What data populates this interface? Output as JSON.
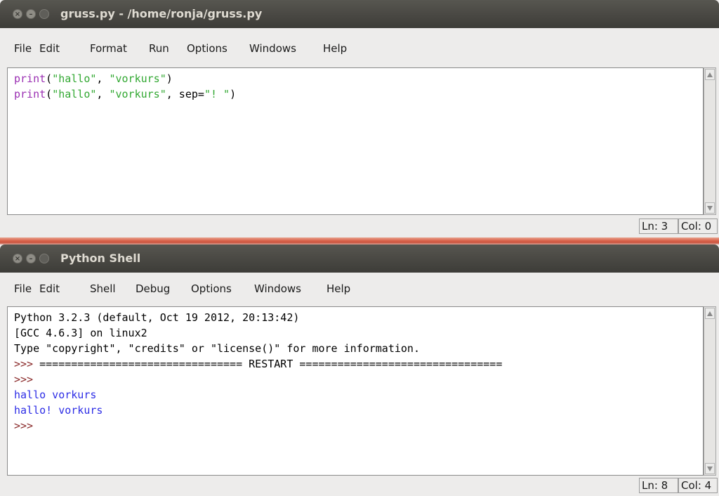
{
  "editor": {
    "title": "gruss.py - /home/ronja/gruss.py",
    "menu": [
      "File",
      "Edit",
      "Format",
      "Run",
      "Options",
      "Windows",
      "Help"
    ],
    "lines": [
      [
        {
          "t": "print",
          "c": "kw"
        },
        {
          "t": "(",
          "c": ""
        },
        {
          "t": "\"hallo\"",
          "c": "str"
        },
        {
          "t": ", ",
          "c": ""
        },
        {
          "t": "\"vorkurs\"",
          "c": "str"
        },
        {
          "t": ")",
          "c": ""
        }
      ],
      [
        {
          "t": "print",
          "c": "kw"
        },
        {
          "t": "(",
          "c": ""
        },
        {
          "t": "\"hallo\"",
          "c": "str"
        },
        {
          "t": ", ",
          "c": ""
        },
        {
          "t": "\"vorkurs\"",
          "c": "str"
        },
        {
          "t": ", sep=",
          "c": ""
        },
        {
          "t": "\"! \"",
          "c": "str"
        },
        {
          "t": ")",
          "c": ""
        }
      ]
    ],
    "status": {
      "ln": "Ln: 3",
      "col": "Col: 0"
    }
  },
  "shell": {
    "title": "Python Shell",
    "menu": [
      "File",
      "Edit",
      "Shell",
      "Debug",
      "Options",
      "Windows",
      "Help"
    ],
    "lines": [
      [
        {
          "t": "Python 3.2.3 (default, Oct 19 2012, 20:13:42)",
          "c": ""
        }
      ],
      [
        {
          "t": "[GCC 4.6.3] on linux2",
          "c": ""
        }
      ],
      [
        {
          "t": "Type \"copyright\", \"credits\" or \"license()\" for more information.",
          "c": ""
        }
      ],
      [
        {
          "t": ">>> ",
          "c": "prompt"
        },
        {
          "t": "================================ RESTART ================================",
          "c": ""
        }
      ],
      [
        {
          "t": ">>> ",
          "c": "prompt"
        }
      ],
      [
        {
          "t": "hallo vorkurs",
          "c": "out"
        }
      ],
      [
        {
          "t": "hallo! vorkurs",
          "c": "out"
        }
      ],
      [
        {
          "t": ">>> ",
          "c": "prompt"
        }
      ]
    ],
    "status": {
      "ln": "Ln: 8",
      "col": "Col: 4"
    }
  },
  "colors": {
    "keyword": "#9b31b3",
    "string": "#32a832",
    "output": "#2d2de6",
    "prompt": "#8a2a2a"
  }
}
